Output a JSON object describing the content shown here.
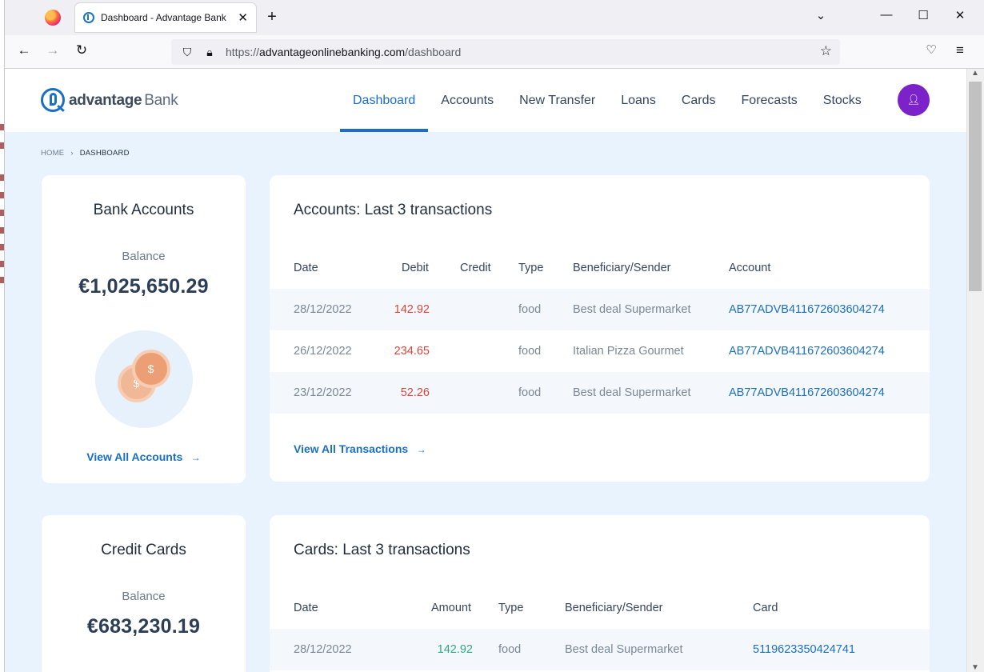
{
  "browser": {
    "tab_title": "Dashboard - Advantage Bank",
    "tab_close": "✕",
    "new_tab": "+",
    "url_prefix": "https://",
    "url_domain": "advantageonlinebanking.com",
    "url_path": "/dashboard"
  },
  "site": {
    "logo_word": "advantage",
    "logo_bank": "Bank",
    "nav": [
      "Dashboard",
      "Accounts",
      "New Transfer",
      "Loans",
      "Cards",
      "Forecasts",
      "Stocks"
    ],
    "active_nav": "Dashboard"
  },
  "breadcrumb": {
    "home": "HOME",
    "current": "DASHBOARD"
  },
  "bank_accounts": {
    "title": "Bank Accounts",
    "balance_label": "Balance",
    "balance": "€1,025,650.29",
    "link": "View All Accounts"
  },
  "accounts_tx": {
    "title": "Accounts: Last 3 transactions",
    "headers": {
      "date": "Date",
      "debit": "Debit",
      "credit": "Credit",
      "type": "Type",
      "beneficiary": "Beneficiary/Sender",
      "account": "Account"
    },
    "rows": [
      {
        "date": "28/12/2022",
        "debit": "142.92",
        "credit": "",
        "type": "food",
        "beneficiary": "Best deal Supermarket",
        "account": "AB77ADVB411672603604274"
      },
      {
        "date": "26/12/2022",
        "debit": "234.65",
        "credit": "",
        "type": "food",
        "beneficiary": "Italian Pizza Gourmet",
        "account": "AB77ADVB411672603604274"
      },
      {
        "date": "23/12/2022",
        "debit": "52.26",
        "credit": "",
        "type": "food",
        "beneficiary": "Best deal Supermarket",
        "account": "AB77ADVB411672603604274"
      }
    ],
    "link": "View All Transactions"
  },
  "credit_cards": {
    "title": "Credit Cards",
    "balance_label": "Balance",
    "balance": "€683,230.19"
  },
  "cards_tx": {
    "title": "Cards: Last 3 transactions",
    "headers": {
      "date": "Date",
      "amount": "Amount",
      "type": "Type",
      "beneficiary": "Beneficiary/Sender",
      "card": "Card"
    },
    "rows": [
      {
        "date": "28/12/2022",
        "amount": "142.92",
        "type": "food",
        "beneficiary": "Best deal Supermarket",
        "card": "5119623350424741"
      }
    ]
  },
  "colors": {
    "brand": "#1a6fc4",
    "debit": "#d9463b",
    "credit": "#2eaa7f",
    "avatar": "#7b22c9",
    "page_bg": "#e8f3fd"
  }
}
